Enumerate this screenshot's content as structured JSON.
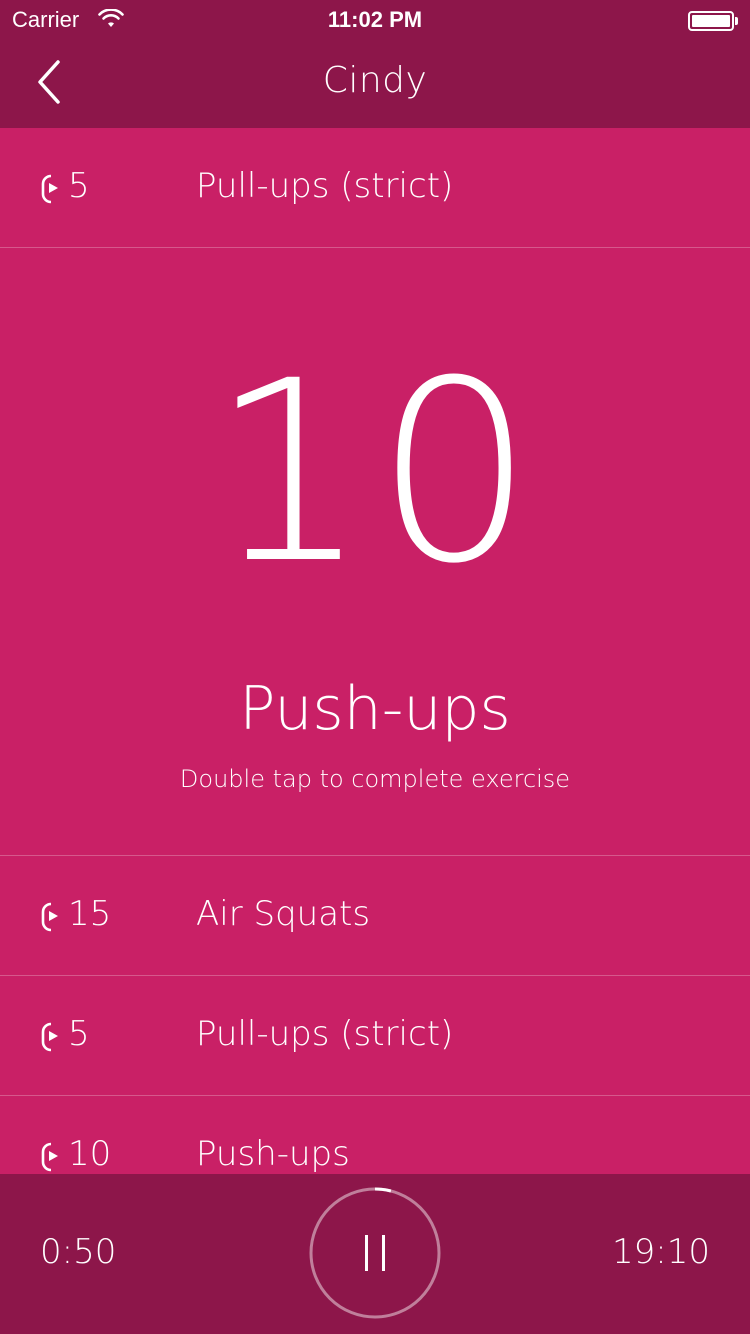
{
  "status_bar": {
    "carrier": "Carrier",
    "time": "11:02 PM"
  },
  "nav": {
    "title": "Cindy"
  },
  "previous_exercise": {
    "reps": "5",
    "name": "Pull-ups (strict)"
  },
  "current_exercise": {
    "count": "10",
    "name": "Push-ups",
    "hint": "Double tap to complete exercise"
  },
  "upcoming": [
    {
      "reps": "15",
      "name": "Air Squats"
    },
    {
      "reps": "5",
      "name": "Pull-ups (strict)"
    },
    {
      "reps": "10",
      "name": "Push-ups"
    }
  ],
  "footer": {
    "elapsed": "0:50",
    "total": "19:10",
    "progress_fraction": 0.04
  },
  "colors": {
    "background": "#c92066",
    "header": "#8d164a",
    "text": "#ffffff"
  }
}
